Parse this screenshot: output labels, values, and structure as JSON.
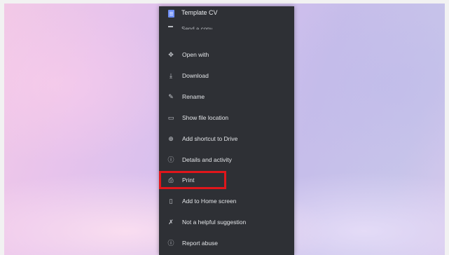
{
  "header": {
    "file_title": "Template CV",
    "cut_off_item": "Send a copy"
  },
  "menu": {
    "items": [
      {
        "label": "Open with",
        "icon": "open-with-icon",
        "glyph": "✥"
      },
      {
        "label": "Download",
        "icon": "download-icon",
        "glyph": "⤓"
      },
      {
        "label": "Rename",
        "icon": "rename-icon",
        "glyph": "✎"
      },
      {
        "label": "Show file location",
        "icon": "folder-icon",
        "glyph": "▭"
      },
      {
        "label": "Add shortcut to Drive",
        "icon": "add-shortcut-icon",
        "glyph": "⊕"
      },
      {
        "label": "Details and activity",
        "icon": "info-icon",
        "glyph": "ⓘ"
      },
      {
        "label": "Print",
        "icon": "print-icon",
        "glyph": "⎙"
      },
      {
        "label": "Add to Home screen",
        "icon": "phone-icon",
        "glyph": "▯"
      },
      {
        "label": "Not a helpful suggestion",
        "icon": "thumb-down-icon",
        "glyph": "✗"
      },
      {
        "label": "Report abuse",
        "icon": "report-icon",
        "glyph": "ⓘ"
      }
    ],
    "highlighted_item": "Print"
  },
  "colors": {
    "menu_background": "#2e3035",
    "highlight_border": "#e0161b",
    "file_icon": "#6f8ff5"
  }
}
